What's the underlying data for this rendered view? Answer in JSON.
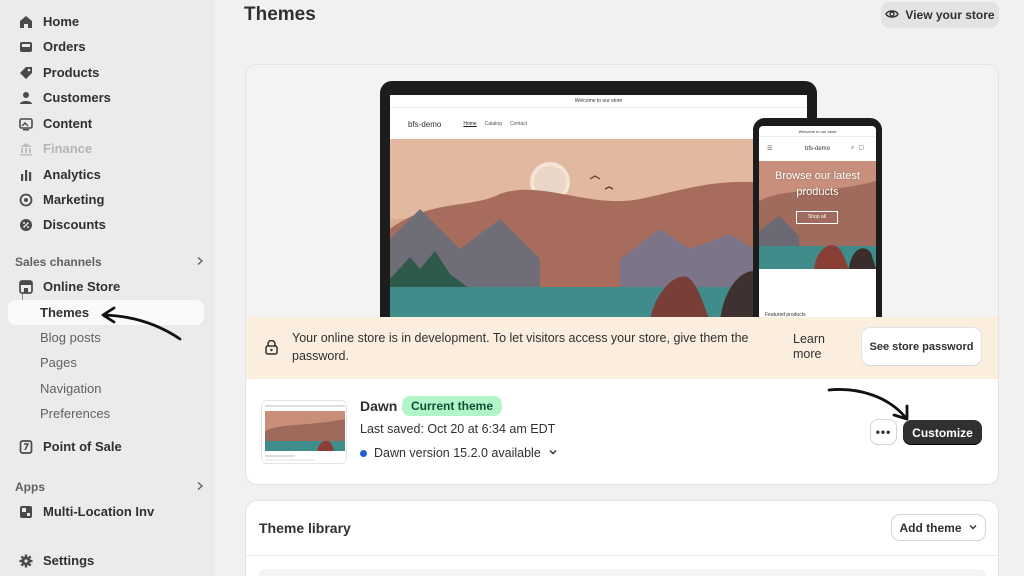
{
  "sidebar": {
    "items": [
      {
        "label": "Home",
        "icon": "home-icon"
      },
      {
        "label": "Orders",
        "icon": "inbox-icon"
      },
      {
        "label": "Products",
        "icon": "tag-icon"
      },
      {
        "label": "Customers",
        "icon": "person-icon"
      },
      {
        "label": "Content",
        "icon": "image-icon"
      },
      {
        "label": "Finance",
        "icon": "bank-icon"
      },
      {
        "label": "Analytics",
        "icon": "bar-chart-icon"
      },
      {
        "label": "Marketing",
        "icon": "target-icon"
      },
      {
        "label": "Discounts",
        "icon": "discount-icon"
      }
    ],
    "sales_channels": {
      "heading": "Sales channels",
      "online_store": "Online Store",
      "sub_items": [
        "Themes",
        "Blog posts",
        "Pages",
        "Navigation",
        "Preferences"
      ],
      "point_of_sale": "Point of Sale"
    },
    "apps": {
      "heading": "Apps",
      "items": [
        "Multi-Location Inv"
      ]
    },
    "settings": "Settings"
  },
  "header": {
    "title": "Themes",
    "view_store": "View your store"
  },
  "preview": {
    "laptop": {
      "welcome": "Welcome to our store",
      "brand": "bfs-demo",
      "nav": [
        "Home",
        "Catalog",
        "Contact"
      ]
    },
    "phone": {
      "welcome": "Welcome to our store",
      "brand": "bfs-demo",
      "hero": "Browse our latest products",
      "shop": "Shop all",
      "featured": "Featured products"
    }
  },
  "banner": {
    "text": "Your online store is in development. To let visitors access your store, give them the password.",
    "learn_more": "Learn more",
    "button": "See store password"
  },
  "current_theme": {
    "name": "Dawn",
    "badge": "Current theme",
    "last_saved": "Last saved: Oct 20 at 6:34 am EDT",
    "version": "Dawn version 15.2.0 available",
    "more": "•••",
    "customize": "Customize"
  },
  "library": {
    "title": "Theme library",
    "add_theme": "Add theme"
  },
  "colors": {
    "accent_dark": "#303030",
    "badge_bg": "#b3f5c8",
    "badge_text": "#0c5132",
    "banner_bg": "#fbeedf",
    "version_dot": "#1f5fd6"
  }
}
